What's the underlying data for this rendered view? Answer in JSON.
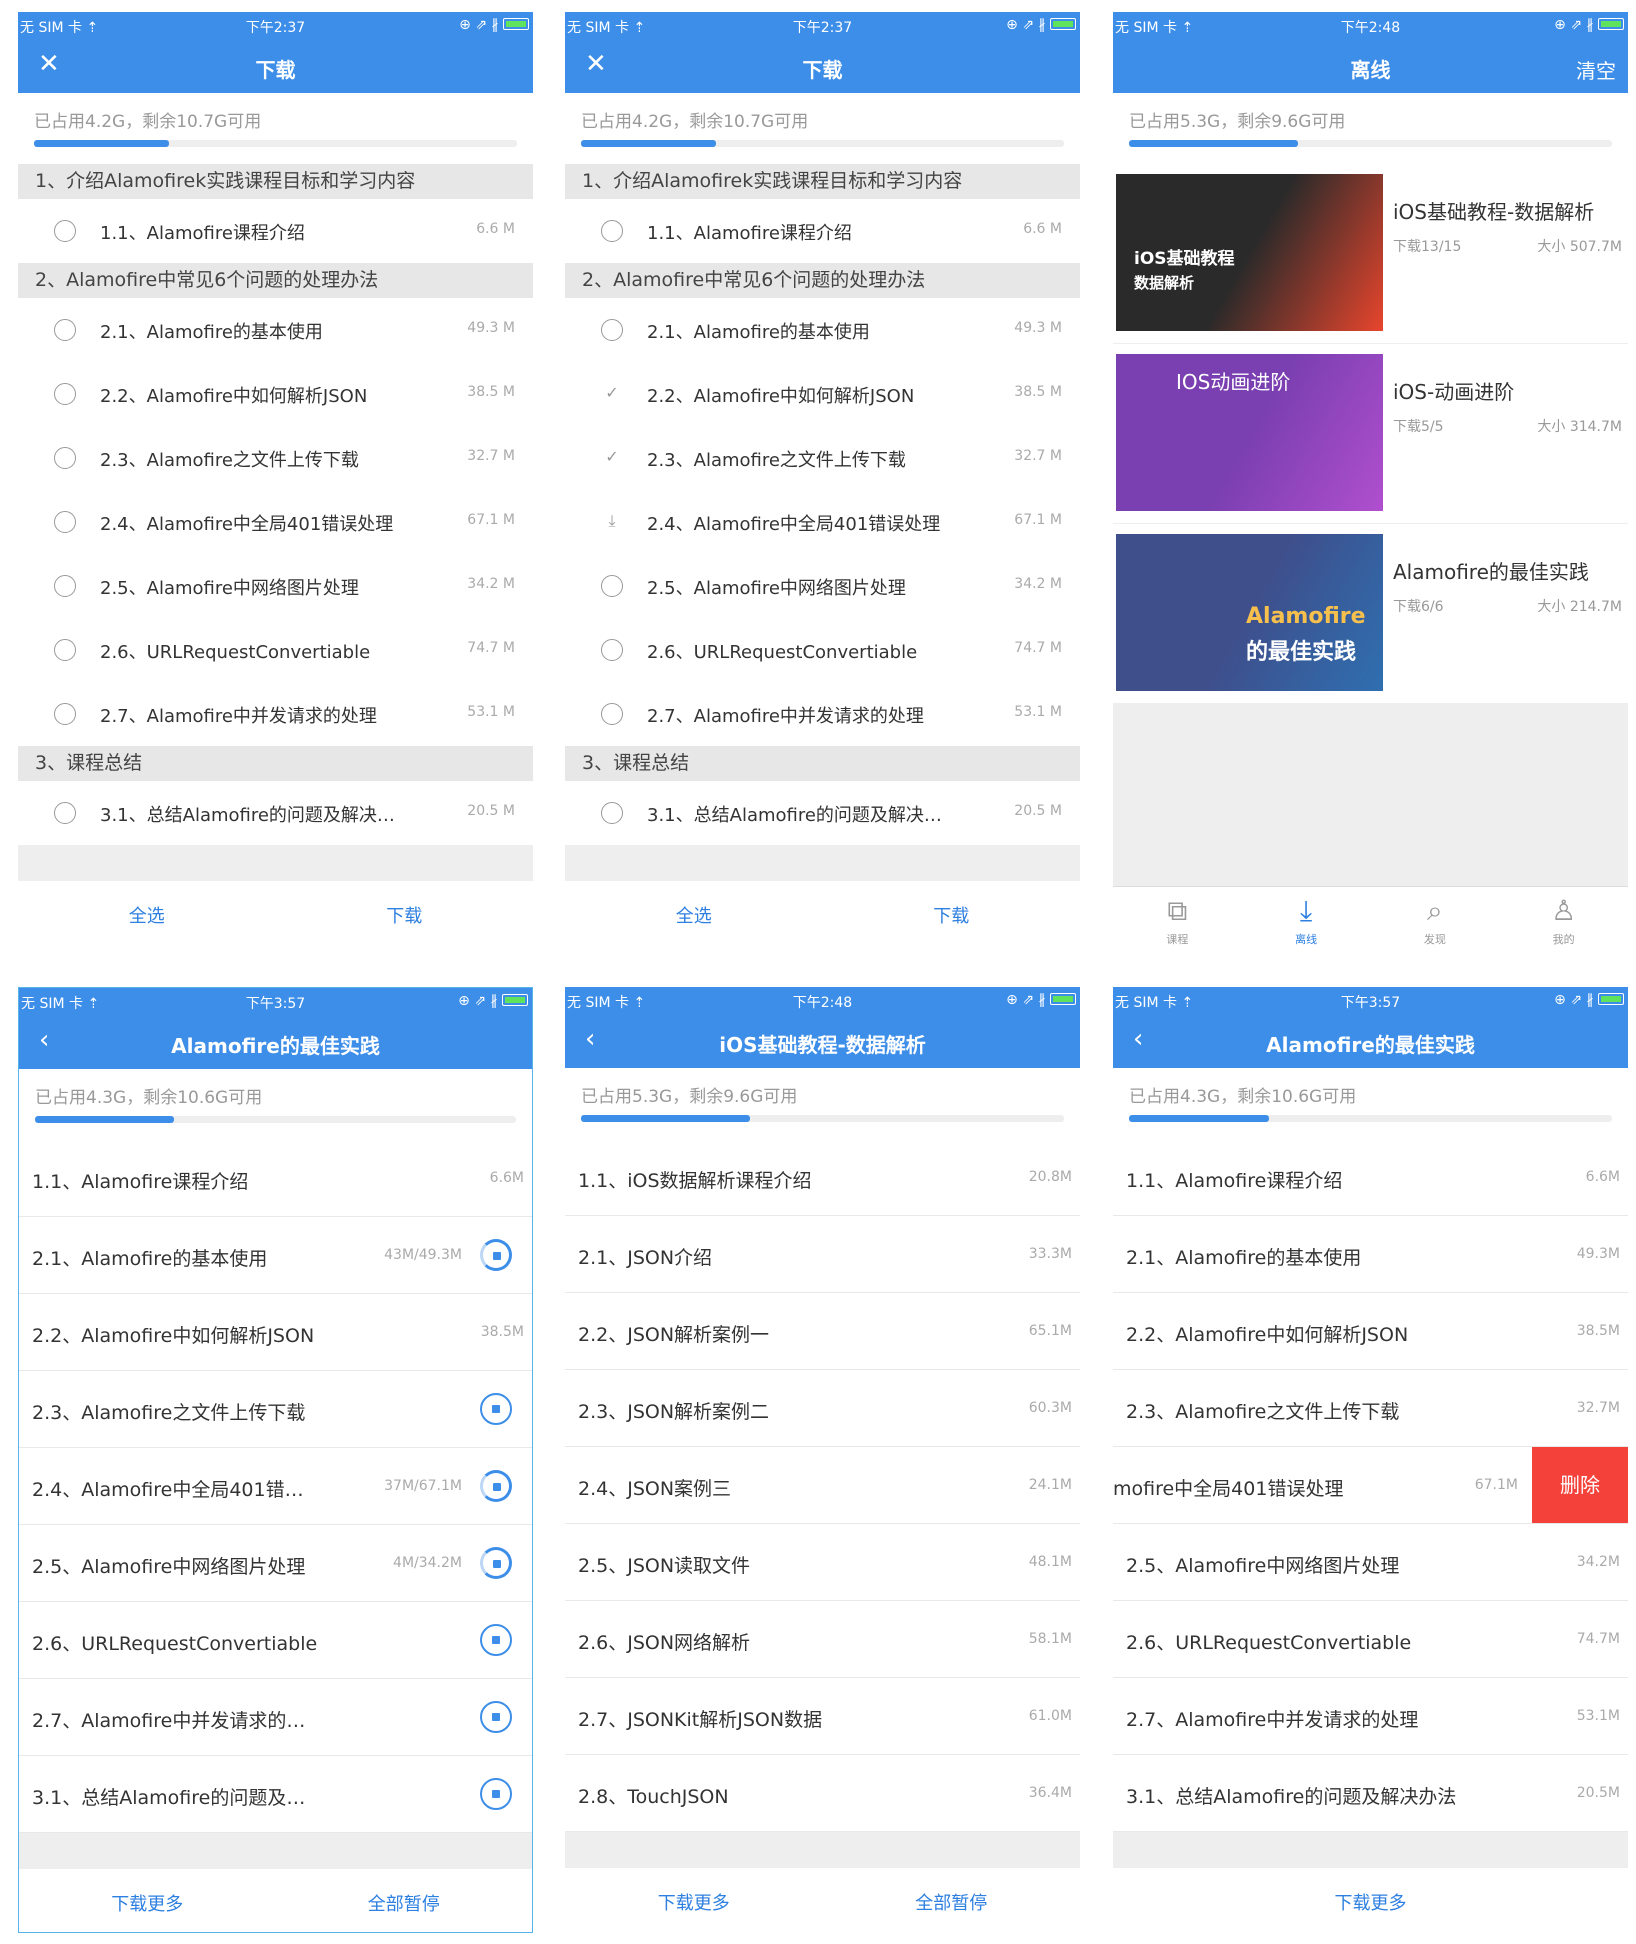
{
  "status": {
    "carrier": "无 SIM 卡 ⇡",
    "icons_right": "⊕ ⇗ ∦",
    "times": [
      "下午2:37",
      "下午2:37",
      "下午2:48",
      "下午3:57",
      "下午2:48",
      "下午3:57"
    ]
  },
  "panel1": {
    "title": "下载",
    "storage": "已占用4.2G，剩余10.7G可用",
    "storage_used_fraction": 0.28,
    "sections": [
      {
        "title": "1、介绍Alamofirek实践课程目标和学习内容",
        "items": [
          {
            "label": "1.1、Alamofire课程介绍",
            "size": "6.6 M"
          }
        ]
      },
      {
        "title": "2、Alamofire中常见6个问题的处理办法",
        "items": [
          {
            "label": "2.1、Alamofire的基本使用",
            "size": "49.3 M"
          },
          {
            "label": "2.2、Alamofire中如何解析JSON",
            "size": "38.5 M"
          },
          {
            "label": "2.3、Alamofire之文件上传下载",
            "size": "32.7 M"
          },
          {
            "label": "2.4、Alamofire中全局401错误处理",
            "size": "67.1 M"
          },
          {
            "label": "2.5、Alamofire中网络图片处理",
            "size": "34.2 M"
          },
          {
            "label": "2.6、URLRequestConvertiable",
            "size": "74.7 M"
          },
          {
            "label": "2.7、Alamofire中并发请求的处理",
            "size": "53.1 M"
          }
        ]
      },
      {
        "title": "3、课程总结",
        "items": [
          {
            "label": "3.1、总结Alamofire的问题及解决…",
            "size": "20.5 M"
          }
        ]
      }
    ],
    "select_all": "全选",
    "download": "下载"
  },
  "panel2": {
    "title": "下载",
    "storage": "已占用4.2G，剩余10.7G可用",
    "storage_used_fraction": 0.28,
    "item_states": [
      "empty",
      "empty",
      "check",
      "check",
      "down",
      "empty",
      "empty",
      "empty",
      "empty"
    ],
    "select_all": "全选",
    "download": "下载"
  },
  "panel3": {
    "title": "离线",
    "clear": "清空",
    "storage": "已占用5.3G，剩余9.6G可用",
    "storage_used_fraction": 0.35,
    "cards": [
      {
        "title": "iOS基础教程-数据解析",
        "meta": "下载13/15",
        "size": "大小 507.7M",
        "thumb_text1": "iOS基础教程",
        "thumb_text2": "数据解析"
      },
      {
        "title": "iOS-动画进阶",
        "meta": "下载5/5",
        "size": "大小 314.7M",
        "thumb_text1": " IOS动画进阶"
      },
      {
        "title": "Alamofire的最佳实践",
        "meta": "下载6/6",
        "size": "大小 214.7M",
        "thumb_text1": "Alamofire",
        "thumb_text2": "的最佳实践"
      }
    ],
    "tabs": [
      {
        "label": "课程",
        "icon": "book-icon"
      },
      {
        "label": "离线",
        "icon": "download-icon"
      },
      {
        "label": "发现",
        "icon": "search-icon"
      },
      {
        "label": "我的",
        "icon": "person-icon"
      }
    ]
  },
  "panel4": {
    "title": "Alamofire的最佳实践",
    "storage": "已占用4.3G，剩余10.6G可用",
    "storage_used_fraction": 0.29,
    "rows": [
      {
        "label": "1.1、Alamofire课程介绍",
        "size": "6.6M",
        "progress": "",
        "stop": "none"
      },
      {
        "label": "2.1、Alamofire的基本使用",
        "size": "",
        "progress": "43M/49.3M",
        "stop": "active"
      },
      {
        "label": "2.2、Alamofire中如何解析JSON",
        "size": "38.5M",
        "progress": "",
        "stop": "none"
      },
      {
        "label": "2.3、Alamofire之文件上传下载",
        "size": "",
        "progress": "",
        "stop": "wait"
      },
      {
        "label": "2.4、Alamofire中全局401错…",
        "size": "",
        "progress": "37M/67.1M",
        "stop": "active"
      },
      {
        "label": "2.5、Alamofire中网络图片处理",
        "size": "",
        "progress": "4M/34.2M",
        "stop": "active"
      },
      {
        "label": "2.6、URLRequestConvertiable",
        "size": "",
        "progress": "",
        "stop": "wait"
      },
      {
        "label": "2.7、Alamofire中并发请求的…",
        "size": "",
        "progress": "",
        "stop": "wait"
      },
      {
        "label": "3.1、总结Alamofire的问题及…",
        "size": "",
        "progress": "",
        "stop": "wait"
      }
    ],
    "more": "下载更多",
    "pause_all": "全部暂停"
  },
  "panel5": {
    "title": "iOS基础教程-数据解析",
    "storage": "已占用5.3G，剩余9.6G可用",
    "storage_used_fraction": 0.35,
    "rows": [
      {
        "label": "1.1、iOS数据解析课程介绍",
        "size": "20.8M"
      },
      {
        "label": "2.1、JSON介绍",
        "size": "33.3M"
      },
      {
        "label": "2.2、JSON解析案例一",
        "size": "65.1M"
      },
      {
        "label": "2.3、JSON解析案例二",
        "size": "60.3M"
      },
      {
        "label": "2.4、JSON案例三",
        "size": "24.1M"
      },
      {
        "label": "2.5、JSON读取文件",
        "size": "48.1M"
      },
      {
        "label": "2.6、JSON网络解析",
        "size": "58.1M"
      },
      {
        "label": "2.7、JSONKit解析JSON数据",
        "size": "61.0M"
      },
      {
        "label": "2.8、TouchJSON",
        "size": "36.4M"
      }
    ],
    "more": "下载更多",
    "pause_all": "全部暂停"
  },
  "panel6": {
    "title": "Alamofire的最佳实践",
    "storage": "已占用4.3G，剩余10.6G可用",
    "storage_used_fraction": 0.29,
    "rows": [
      {
        "label": "1.1、Alamofire课程介绍",
        "size": "6.6M"
      },
      {
        "label": "2.1、Alamofire的基本使用",
        "size": "49.3M"
      },
      {
        "label": "2.2、Alamofire中如何解析JSON",
        "size": "38.5M"
      },
      {
        "label": "2.3、Alamofire之文件上传下载",
        "size": "32.7M"
      },
      {
        "label": "mofire中全局401错误处理",
        "size": "67.1M",
        "swiped": true
      },
      {
        "label": "2.5、Alamofire中网络图片处理",
        "size": "34.2M"
      },
      {
        "label": "2.6、URLRequestConvertiable",
        "size": "74.7M"
      },
      {
        "label": "2.7、Alamofire中并发请求的处理",
        "size": "53.1M"
      },
      {
        "label": "3.1、总结Alamofire的问题及解决办法",
        "size": "20.5M"
      }
    ],
    "delete": "删除",
    "more": "下载更多"
  }
}
